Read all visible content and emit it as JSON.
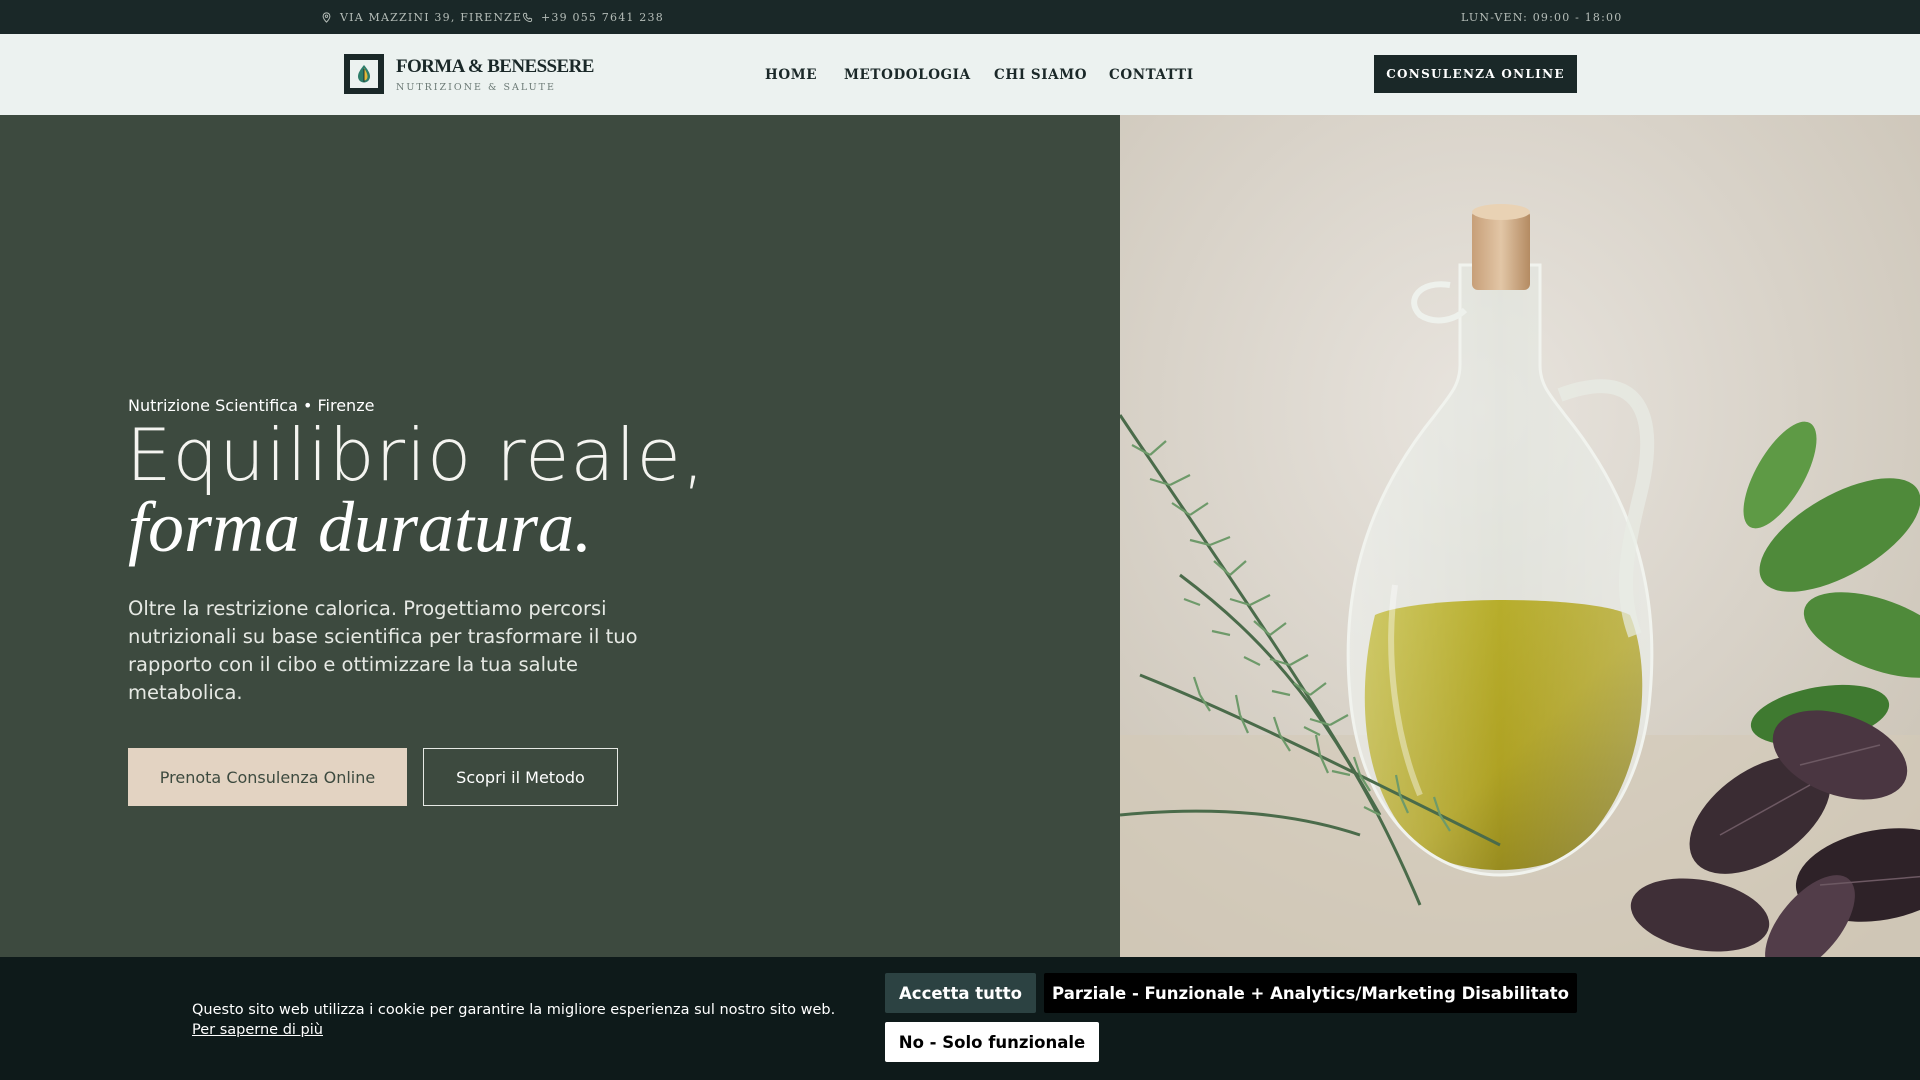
{
  "topbar": {
    "address": "VIA MAZZINI 39, FIRENZE",
    "phone": "+39 055 7641 238",
    "hours": "LUN-VEN: 09:00 - 18:00"
  },
  "header": {
    "brand_name": "FORMA & BENESSERE",
    "brand_tagline": "NUTRIZIONE & SALUTE",
    "nav": [
      "HOME",
      "METODOLOGIA",
      "CHI SIAMO",
      "CONTATTI"
    ],
    "cta_label": "CONSULENZA ONLINE"
  },
  "hero": {
    "eyebrow": "Nutrizione Scientifica • Firenze",
    "title_line1": "Equilibrio reale,",
    "title_line2": "forma duratura.",
    "lead": "Oltre la restrizione calorica. Progettiamo percorsi nutrizionali su base scientifica per trasformare il tuo rapporto con il cibo e ottimizzare la tua salute metabolica.",
    "primary_button": "Prenota Consulenza Online",
    "secondary_button": "Scopri il Metodo"
  },
  "cookie": {
    "text": "Questo sito web utilizza i cookie per garantire la migliore esperienza sul nostro sito web.",
    "link": "Per saperne di più",
    "accept_all": "Accetta tutto",
    "partial": "Parziale - Funzionale + Analytics/Marketing Disabilitato",
    "no": "No - Solo funzionale"
  },
  "colors": {
    "dark_teal": "#1a2828",
    "hero_green": "#3d4a3f",
    "header_bg": "#ecf2f0",
    "accent_beige": "#e3d3c2"
  },
  "icons": [
    "location-pin-icon",
    "phone-icon",
    "leaf-logo-icon"
  ]
}
